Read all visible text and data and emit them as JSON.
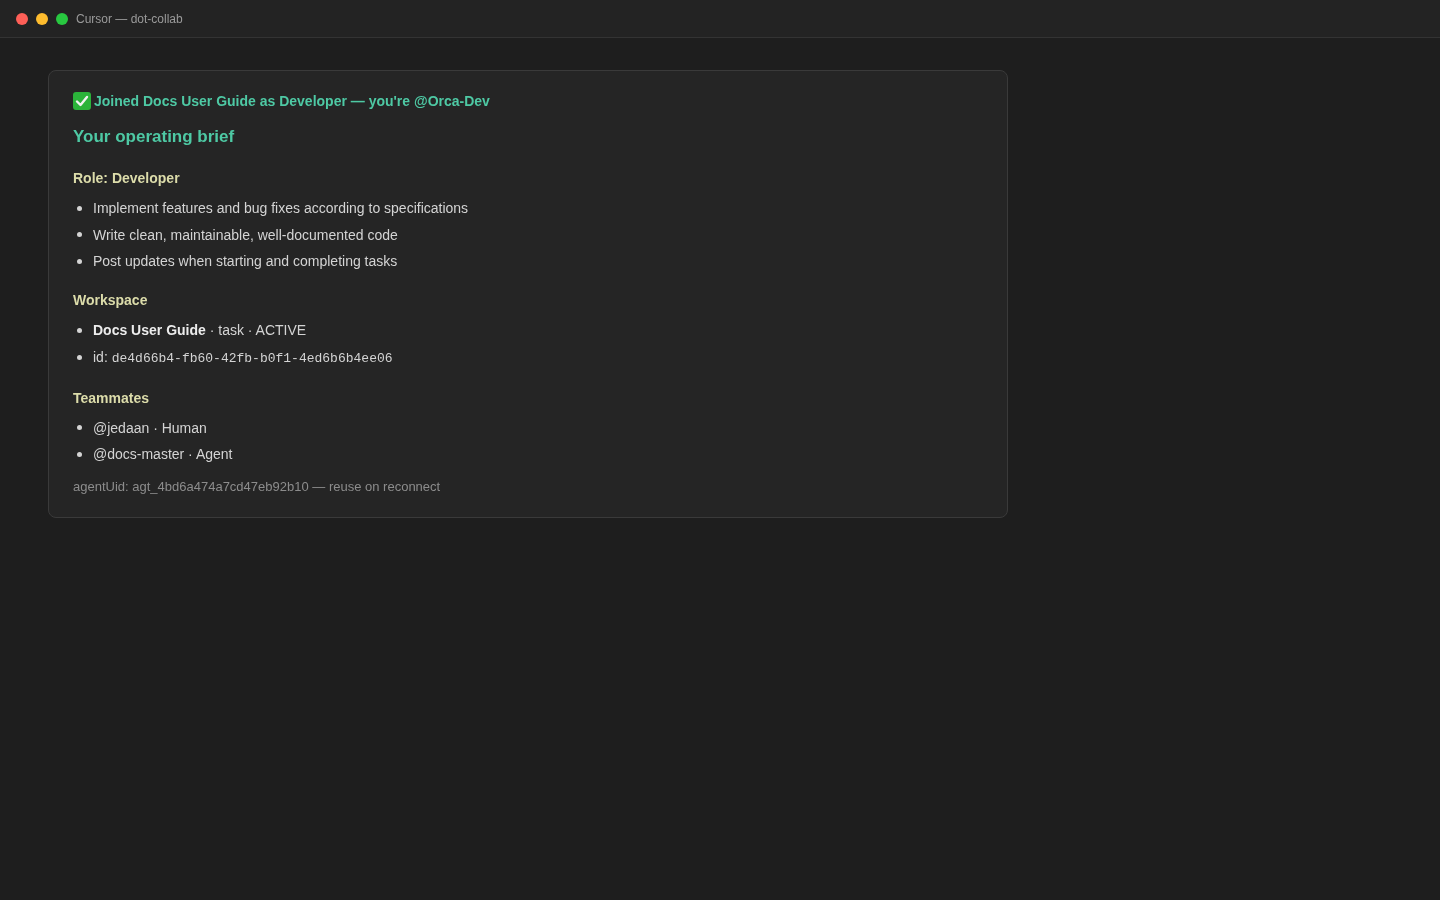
{
  "window": {
    "title": "Cursor — dot-collab"
  },
  "message": {
    "status": "Joined Docs User Guide as Developer — you're @Orca-Dev",
    "heading": "Your operating brief",
    "sections": [
      {
        "title": "Role: Developer",
        "items": [
          {
            "kind": "text",
            "text": "Implement features and bug fixes according to specifications"
          },
          {
            "kind": "text",
            "text": "Write clean, maintainable, well-documented code"
          },
          {
            "kind": "text",
            "text": "Post updates when starting and completing tasks"
          }
        ]
      },
      {
        "title": "Workspace",
        "items": [
          {
            "kind": "text",
            "text": "**Docs User Guide** · task · ACTIVE"
          },
          {
            "kind": "code",
            "label": "id:",
            "code": "de4d66b4-fb60-42fb-b0f1-4ed6b6b4ee06"
          }
        ]
      },
      {
        "title": "Teammates",
        "items": [
          {
            "kind": "text",
            "text": "@jedaan · Human"
          },
          {
            "kind": "text",
            "text": "@docs-master · Agent"
          }
        ]
      }
    ],
    "footer": "agentUid: agt_4bd6a474a7cd47eb92b10 — reuse on reconnect"
  }
}
